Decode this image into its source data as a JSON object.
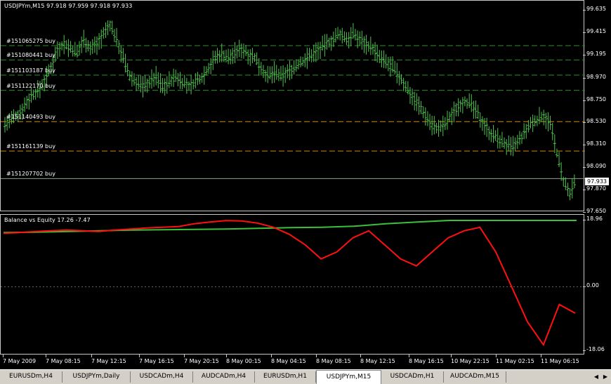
{
  "main_chart": {
    "header": "USDJPYm,M15  97.918 97.959 97.918 97.933",
    "current_price": "97.933",
    "price_ticks": [
      "99.635",
      "99.415",
      "99.195",
      "98.970",
      "98.750",
      "98.530",
      "98.310",
      "98.090",
      "97.870",
      "97.650"
    ],
    "orders": [
      {
        "label": "#151065275 buy",
        "price": 99.33
      },
      {
        "label": "#151080441 buy",
        "price": 99.18
      },
      {
        "label": "#151103187 buy",
        "price": 99.02
      },
      {
        "label": "#151122170 buy",
        "price": 98.86
      },
      {
        "label": "#151140493 buy",
        "price": 98.53
      },
      {
        "label": "#151161139 buy",
        "price": 98.22
      },
      {
        "label": "#151207702 buy",
        "price": 97.93
      }
    ]
  },
  "sub_chart": {
    "header": "Balance vs Equity 17.26 -7.47",
    "ticks": [
      "18.96",
      "0.00",
      "-18.06"
    ]
  },
  "time_axis": [
    "7 May 2009",
    "7 May 08:15",
    "7 May 12:15",
    "7 May 16:15",
    "7 May 20:15",
    "8 May 00:15",
    "8 May 04:15",
    "8 May 08:15",
    "8 May 12:15",
    "8 May 16:15",
    "10 May 22:15",
    "11 May 02:15",
    "11 May 06:15"
  ],
  "tabs": [
    "EURUSDm,H4",
    "USDJPYm,Daily",
    "USDCADm,H4",
    "AUDCADm,H4",
    "EURUSDm,H1",
    "USDJPYm,M15",
    "USDCADm,H1",
    "AUDCADm,M15"
  ],
  "active_tab": "USDJPYm,M15",
  "chart_data": [
    {
      "type": "line",
      "title": "USDJPYm,M15",
      "ylim": [
        97.6,
        99.7
      ],
      "series": [
        {
          "values": [
            98.5,
            98.55,
            98.6,
            98.7,
            98.8,
            98.85,
            98.95,
            99.1,
            99.3,
            99.35,
            99.3,
            99.25,
            99.4,
            99.3,
            99.35,
            99.45,
            99.55,
            99.4,
            99.2,
            99.0,
            98.95,
            98.9,
            98.95,
            99.0,
            98.9,
            98.95,
            99.0,
            98.95,
            98.9,
            98.95,
            99.0,
            99.1,
            99.2,
            99.25,
            99.2,
            99.25,
            99.3,
            99.25,
            99.2,
            99.1,
            99.0,
            99.05,
            99.0,
            99.05,
            99.1,
            99.15,
            99.2,
            99.25,
            99.3,
            99.35,
            99.4,
            99.45,
            99.4,
            99.45,
            99.4,
            99.35,
            99.3,
            99.2,
            99.15,
            99.1,
            99.0,
            98.9,
            98.8,
            98.7,
            98.6,
            98.5,
            98.45,
            98.5,
            98.6,
            98.7,
            98.75,
            98.7,
            98.6,
            98.5,
            98.4,
            98.35,
            98.3,
            98.25,
            98.3,
            98.4,
            98.5,
            98.55,
            98.6,
            98.5,
            98.2,
            97.9,
            97.75,
            97.93
          ]
        }
      ]
    },
    {
      "type": "line",
      "title": "Balance vs Equity",
      "ylim": [
        -18.06,
        18.96
      ],
      "series": [
        {
          "values": [
            15.5,
            15.6,
            15.8,
            16.0,
            16.2,
            16.3,
            16.4,
            16.5,
            16.7,
            16.9,
            17.0,
            17.3,
            18.0,
            18.5,
            18.96,
            18.96,
            18.96,
            18.96,
            18.96
          ]
        },
        {
          "values": [
            15.3,
            15.5,
            15.8,
            16.0,
            16.2,
            16.0,
            15.8,
            16.2,
            16.5,
            16.8,
            17.0,
            17.2,
            18.0,
            18.5,
            18.9,
            18.8,
            18.2,
            17.0,
            15.0,
            12.0,
            8.0,
            10.0,
            14.0,
            16.0,
            12.0,
            8.0,
            6.0,
            10.0,
            14.0,
            16.0,
            17.0,
            10.0,
            0.0,
            -10.0,
            -16.5,
            -5.0,
            -7.47
          ]
        }
      ]
    }
  ],
  "colors": {
    "bars": "#4ec24e",
    "order_green": "#2e8b2e",
    "order_orange": "#d08a00",
    "balance": "#3ac03a",
    "equity": "#ff1010",
    "grid": "#c8c8c8"
  }
}
